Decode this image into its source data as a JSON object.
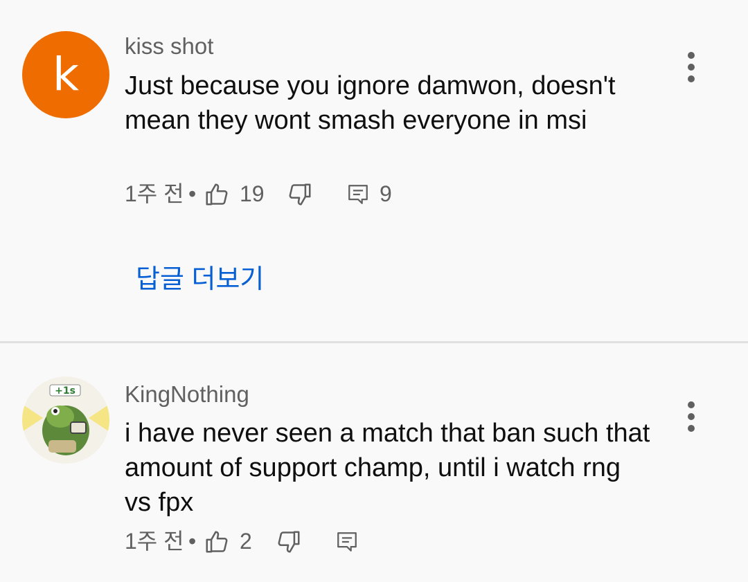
{
  "comments": [
    {
      "author": "kiss shot",
      "avatar_letter": "k",
      "avatar_color": "#ef6c00",
      "text": "Just because you ignore damwon, doesn't mean they wont smash everyone in msi",
      "time": "1주 전",
      "separator": "•",
      "likes": "19",
      "replies": "9",
      "more_replies_label": "답글 더보기"
    },
    {
      "author": "KingNothing",
      "avatar_icon": "frog-avatar-icon",
      "text": "i have never seen a match that ban such that amount of support champ, until i watch rng vs fpx",
      "time": "1주 전",
      "separator": "•",
      "likes": "2"
    }
  ],
  "colors": {
    "background": "#f9f9f9",
    "secondary_text": "#606060",
    "link": "#065fd4",
    "divider": "#e0e0e0"
  }
}
